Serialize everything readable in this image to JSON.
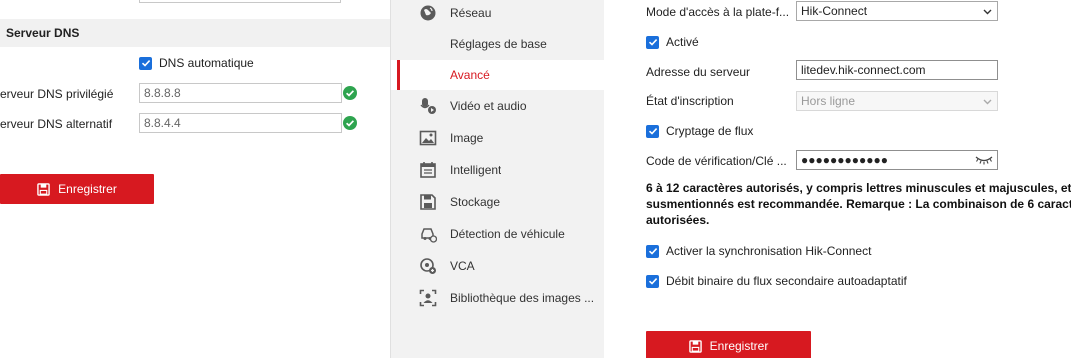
{
  "left_panel": {
    "section_title": "Serveur DNS",
    "dns_auto": {
      "label": "DNS automatique",
      "checked": true
    },
    "dns_preferred": {
      "label": "erveur DNS privilégié",
      "value": "8.8.8.8"
    },
    "dns_alternate": {
      "label": "erveur DNS alternatif",
      "value": "8.8.4.4"
    },
    "save_label": "Enregistrer"
  },
  "nav": {
    "items": [
      {
        "label": "Réseau",
        "icon": "globe-icon"
      },
      {
        "label": "Réglages de base",
        "icon": ""
      },
      {
        "label": "Avancé",
        "icon": "",
        "active": true
      },
      {
        "label": "Vidéo et audio",
        "icon": "video-audio-icon"
      },
      {
        "label": "Image",
        "icon": "image-icon"
      },
      {
        "label": "Intelligent",
        "icon": "calendar-icon"
      },
      {
        "label": "Stockage",
        "icon": "storage-icon"
      },
      {
        "label": "Détection de véhicule",
        "icon": "vehicle-icon"
      },
      {
        "label": "VCA",
        "icon": "vca-icon"
      },
      {
        "label": "Bibliothèque des images ...",
        "icon": "face-library-icon"
      }
    ]
  },
  "form": {
    "access_mode": {
      "label": "Mode d'accès à la plate-f...",
      "value": "Hik-Connect"
    },
    "enabled": {
      "label": "Activé",
      "checked": true
    },
    "server_address": {
      "label": "Adresse du serveur",
      "value": "litedev.hik-connect.com"
    },
    "registration_state": {
      "label": "État d'inscription",
      "value": "Hors ligne"
    },
    "stream_encryption": {
      "label": "Cryptage de flux",
      "checked": true
    },
    "verification_code": {
      "label": "Code de vérification/Clé ...",
      "value": "●●●●●●●●●●●●"
    },
    "note_line1": "6 à 12 caractères autorisés, y compris lettres minuscules et majuscules, et",
    "note_line2": "susmentionnés est recommandée. Remarque : La combinaison de 6 caract",
    "note_line3": "autorisées.",
    "sync_hik": {
      "label": "Activer la synchronisation Hik-Connect",
      "checked": true
    },
    "adaptive_bitrate": {
      "label": "Débit binaire du flux secondaire autoadaptatif",
      "checked": true
    },
    "save_label": "Enregistrer"
  },
  "colors": {
    "accent_red": "#d71920",
    "checkbox_blue": "#1a6fdb",
    "valid_green": "#2ea44f",
    "nav_bg": "#f2f2f2"
  }
}
